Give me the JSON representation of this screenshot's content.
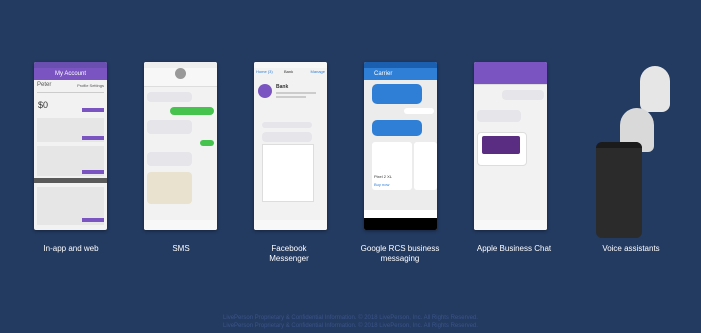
{
  "channels": [
    {
      "label": "In-app and web"
    },
    {
      "label": "SMS"
    },
    {
      "label": "Facebook Messenger"
    },
    {
      "label": "Google RCS business messaging"
    },
    {
      "label": "Apple Business Chat"
    },
    {
      "label": "Voice assistants"
    }
  ],
  "screens": {
    "inapp_title": "My Account",
    "inapp_user": "Peter",
    "inapp_profile": "Profile Settings",
    "inapp_balance": "$0",
    "fb_back": "Home (3)",
    "fb_manage": "Manage",
    "fb_page": "Bank",
    "fb_name": "Bank",
    "rcs_title": "Carrier",
    "rcs_product": "Pixel 2 XL",
    "rcs_buy": "Buy now"
  },
  "footer": {
    "line1": "LivePerson Proprietary & Confidential Information. © 2018 LivePerson, Inc. All Rights Reserved.",
    "line2": "LivePerson Proprietary & Confidential Information. © 2018 LivePerson, Inc. All Rights Reserved."
  },
  "colors": {
    "background": "#233a61",
    "brand_purple": "#7a55c2",
    "sms_green": "#46c34f",
    "rcs_blue": "#2f7fd6"
  }
}
